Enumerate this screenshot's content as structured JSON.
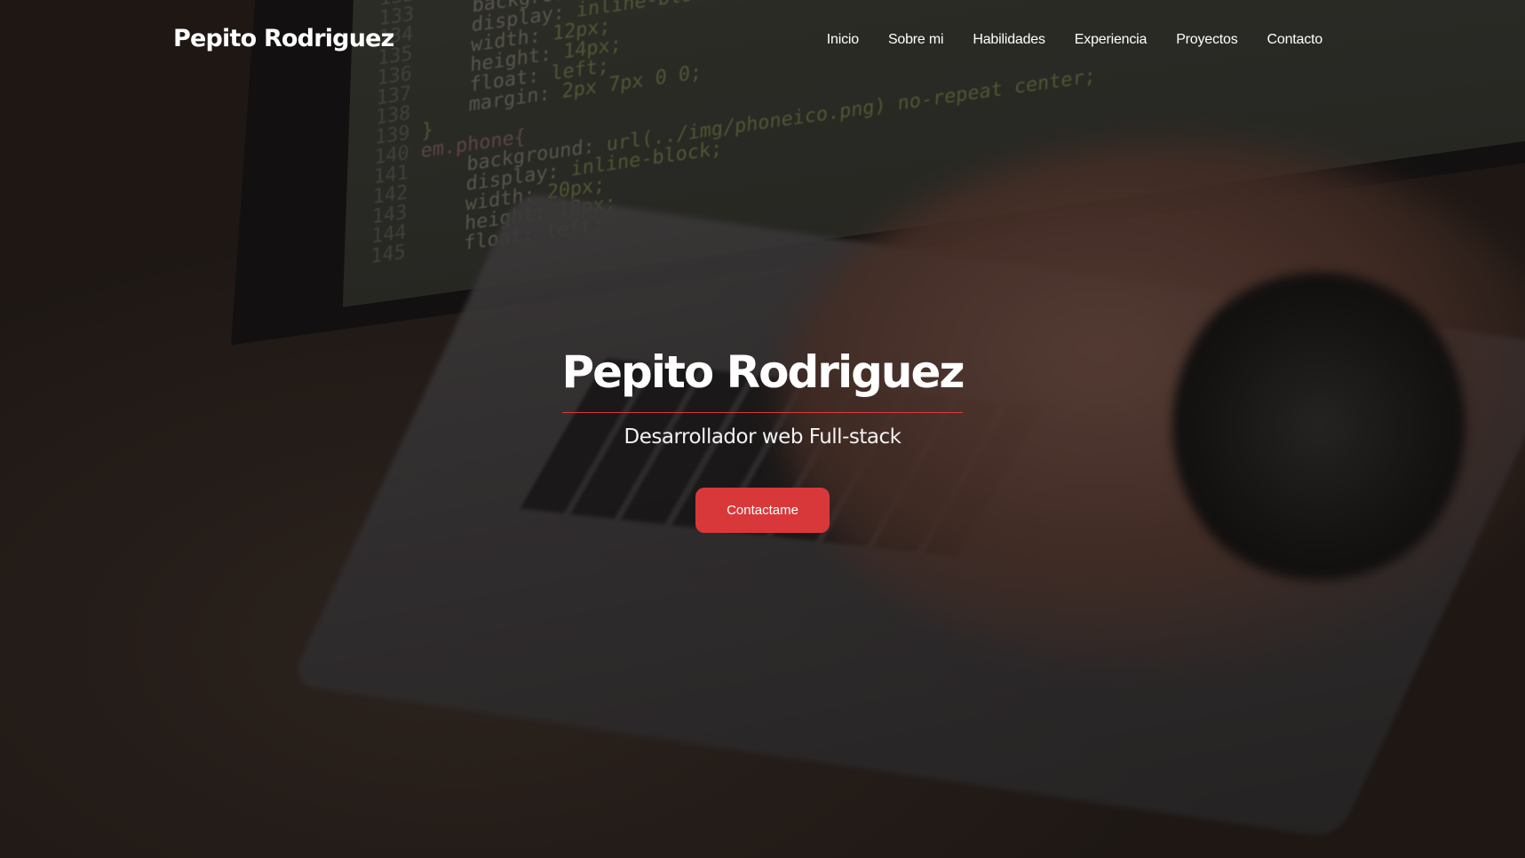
{
  "navbar": {
    "brand": "Pepito Rodriguez",
    "items": [
      {
        "label": "Inicio"
      },
      {
        "label": "Sobre mi"
      },
      {
        "label": "Habilidades"
      },
      {
        "label": "Experiencia"
      },
      {
        "label": "Proyectos"
      },
      {
        "label": "Contacto"
      }
    ]
  },
  "hero": {
    "title": "Pepito Rodriguez",
    "subtitle": "Desarrollador web Full-stack",
    "cta_label": "Contactame",
    "accent_color": "#d9383a"
  }
}
